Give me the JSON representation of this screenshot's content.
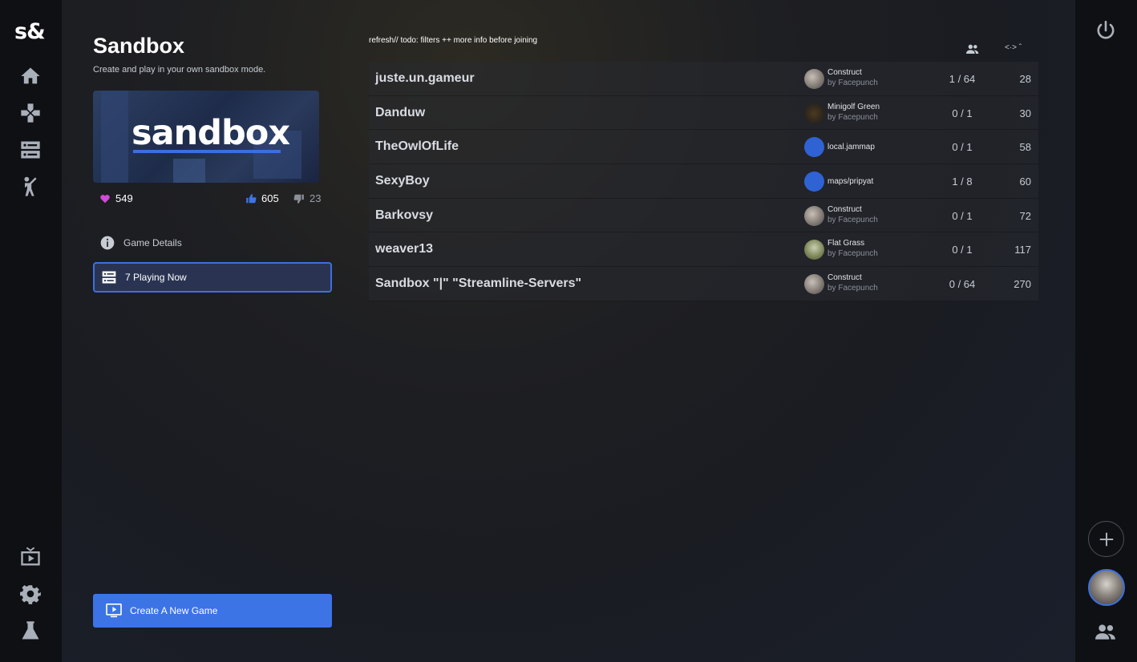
{
  "app": {
    "logo_text": "s&"
  },
  "game": {
    "title": "Sandbox",
    "subtitle": "Create and play in your own sandbox mode.",
    "thumbnail_word": "sandbox",
    "favorites": "549",
    "upvotes": "605",
    "downvotes": "23"
  },
  "sidebar": {
    "details_label": "Game Details",
    "playing_label": "7 Playing Now",
    "create_label": "Create A New Game"
  },
  "server_list": {
    "header_text": "refresh// todo: filters ++ more info before joining",
    "ping_header": "<·> ˆ",
    "rows": [
      {
        "name": "juste.un.gameur",
        "map": "Construct",
        "author": "by Facepunch",
        "players": "1 / 64",
        "ping": "28",
        "map_style": "construct"
      },
      {
        "name": "Danduw",
        "map": "Minigolf Green",
        "author": "by Facepunch",
        "players": "0 / 1",
        "ping": "30",
        "map_style": "minigolf"
      },
      {
        "name": "TheOwlOfLife",
        "map": "local.jammap",
        "author": "",
        "players": "0 / 1",
        "ping": "58",
        "map_style": "blue"
      },
      {
        "name": "SexyBoy",
        "map": "maps/pripyat",
        "author": "",
        "players": "1 / 8",
        "ping": "60",
        "map_style": "blue"
      },
      {
        "name": "Barkovsy",
        "map": "Construct",
        "author": "by Facepunch",
        "players": "0 / 1",
        "ping": "72",
        "map_style": "construct"
      },
      {
        "name": "weaver13",
        "map": "Flat Grass",
        "author": "by Facepunch",
        "players": "0 / 1",
        "ping": "117",
        "map_style": "flat"
      },
      {
        "name": "Sandbox \"|\" \"Streamline-Servers\"",
        "map": "Construct",
        "author": "by Facepunch",
        "players": "0 / 64",
        "ping": "270",
        "map_style": "construct"
      }
    ]
  },
  "colors": {
    "accent": "#3c74e6",
    "heart": "#d04bd8",
    "thumb_up": "#3c74e6"
  }
}
